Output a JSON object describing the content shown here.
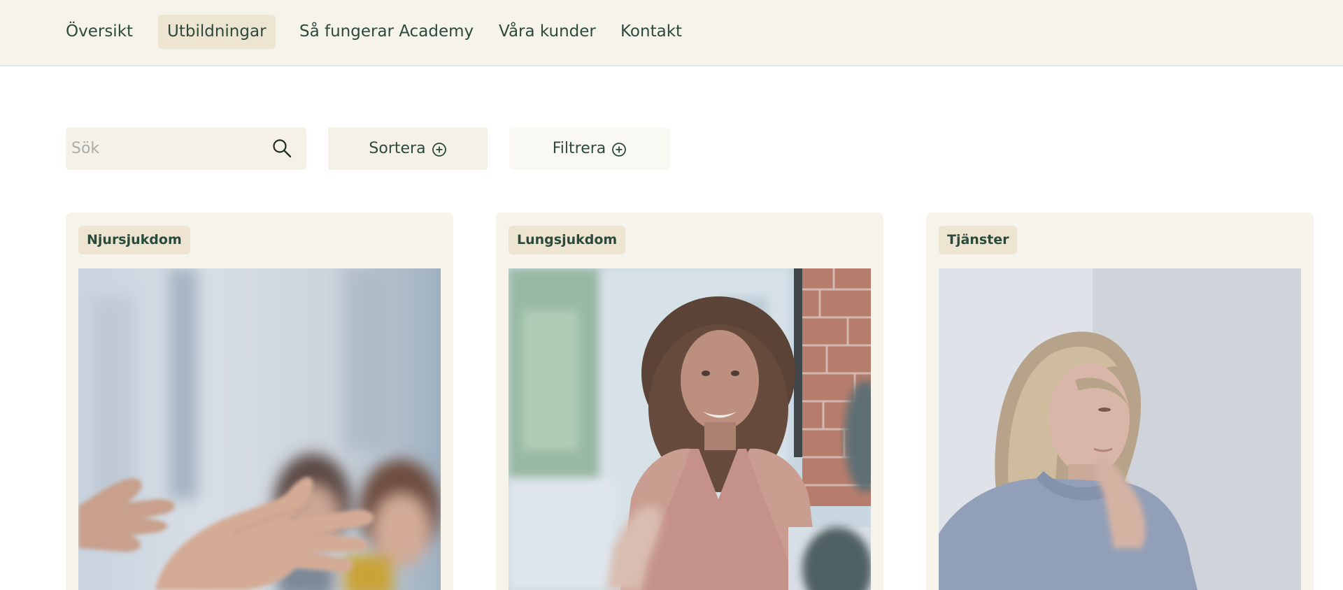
{
  "nav": {
    "items": [
      {
        "label": "Översikt",
        "active": false
      },
      {
        "label": "Utbildningar",
        "active": true
      },
      {
        "label": "Så fungerar Academy",
        "active": false
      },
      {
        "label": "Våra kunder",
        "active": false
      },
      {
        "label": "Kontakt",
        "active": false
      }
    ]
  },
  "toolbar": {
    "search_placeholder": "Sök",
    "search_value": "",
    "search_icon": "search-icon",
    "sort_label": "Sortera",
    "filter_label": "Filtrera",
    "plus_icon": "plus-circle-icon"
  },
  "cards": [
    {
      "tag": "Njursjukdom",
      "image": "people-gesturing-hands-photo"
    },
    {
      "tag": "Lungsjukdom",
      "image": "smiling-woman-curly-hair-photo"
    },
    {
      "tag": "Tjänster",
      "image": "thoughtful-blonde-woman-photo"
    }
  ],
  "colors": {
    "nav_background": "#f6f3ea",
    "active_pill": "#ede5d2",
    "card_background": "#f6f3ea",
    "text": "#2c4a3c"
  }
}
